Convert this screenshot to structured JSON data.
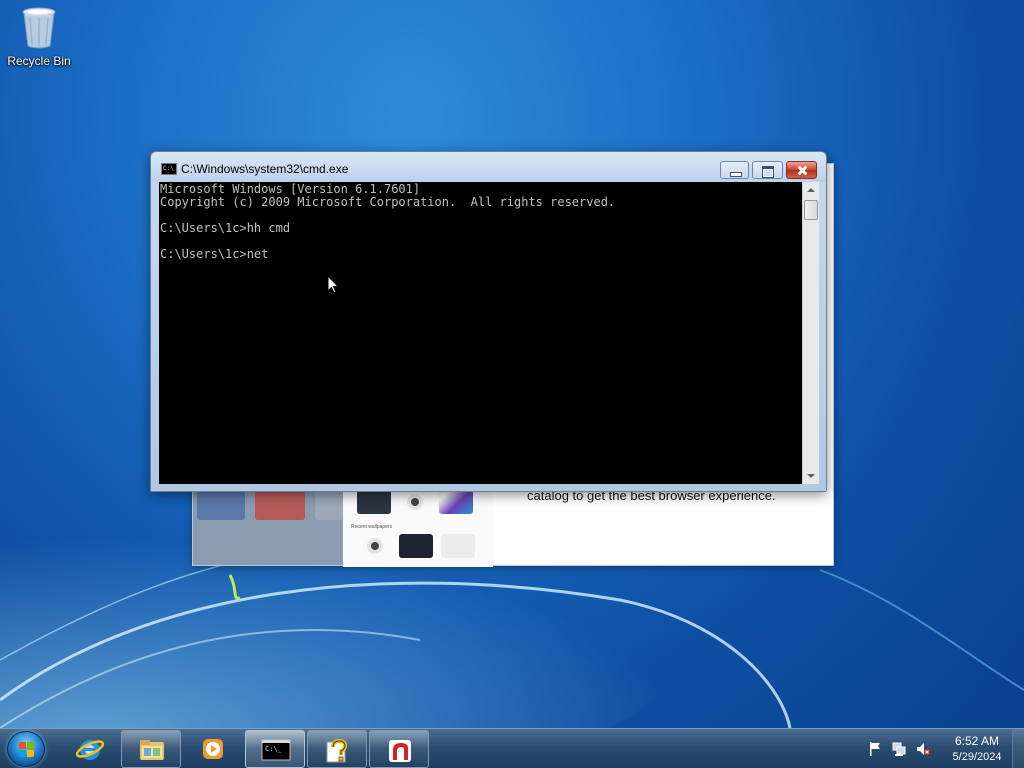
{
  "desktop": {
    "icons": [
      {
        "label": "Recycle Bin",
        "icon": "recycle-bin-icon"
      }
    ]
  },
  "background_window": {
    "visible_text": "catalog to get the best browser experience.",
    "recent_wallpapers_label": "Recent wallpapers"
  },
  "cmd_window": {
    "title": "C:\\Windows\\system32\\cmd.exe",
    "icon_text": "C:\\",
    "console_lines": [
      "Microsoft Windows [Version 6.1.7601]",
      "Copyright (c) 2009 Microsoft Corporation.  All rights reserved.",
      "",
      "C:\\Users\\1c>hh cmd",
      "",
      "C:\\Users\\1c>net"
    ],
    "buttons": {
      "minimize": "minimize-icon",
      "maximize": "maximize-icon",
      "close": "close-icon"
    }
  },
  "taskbar": {
    "start": "windows-logo-icon",
    "pinned": [
      {
        "name": "internet-explorer",
        "icon": "internet-explorer-icon",
        "state": "pinned"
      },
      {
        "name": "windows-explorer",
        "icon": "folder-icon",
        "state": "open"
      },
      {
        "name": "media-player",
        "icon": "media-player-icon",
        "state": "pinned"
      },
      {
        "name": "command-prompt",
        "icon": "cmd-icon",
        "state": "active"
      },
      {
        "name": "help",
        "icon": "help-icon",
        "state": "open"
      },
      {
        "name": "app-red",
        "icon": "red-app-icon",
        "state": "open"
      }
    ],
    "tray": {
      "icons": [
        "action-center-flag-icon",
        "network-icon",
        "volume-muted-icon"
      ],
      "time": "6:52 AM",
      "date": "5/29/2024"
    }
  },
  "colors": {
    "desktop_blue": "#1a6cc4",
    "console_bg": "#000000",
    "console_text": "#c0c0c0",
    "close_red": "#c7432f"
  }
}
